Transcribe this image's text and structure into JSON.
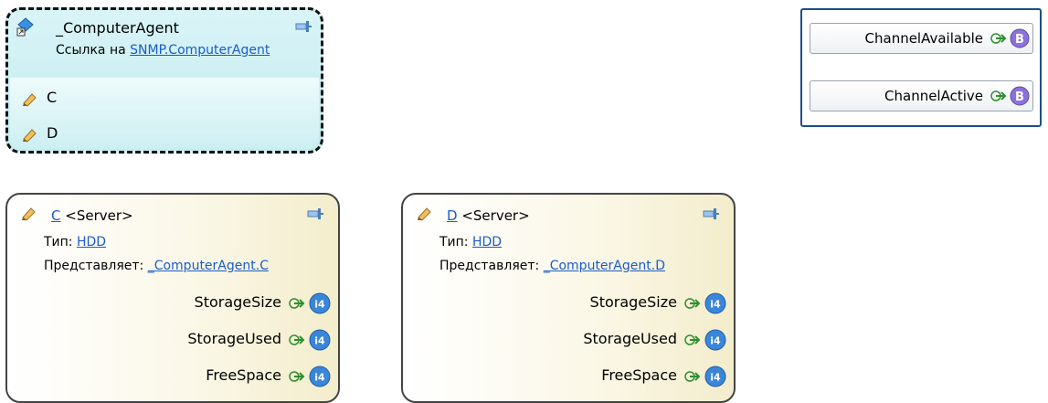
{
  "agent": {
    "title": "_ComputerAgent",
    "ref_prefix": "Ссылка на ",
    "ref_link": "SNMP.ComputerAgent",
    "items": [
      "C",
      "D"
    ]
  },
  "channels": [
    {
      "label": "ChannelAvailable",
      "badge": "B"
    },
    {
      "label": "ChannelActive",
      "badge": "B"
    }
  ],
  "servers": [
    {
      "name": "C",
      "type_tag": " <Server>",
      "type_label": "Тип: ",
      "type_value": "HDD",
      "represents_label": "Представляет: ",
      "represents_value": "_ComputerAgent.C",
      "props": [
        {
          "label": "StorageSize",
          "badge": "i4"
        },
        {
          "label": "StorageUsed",
          "badge": "i4"
        },
        {
          "label": "FreeSpace",
          "badge": "i4"
        }
      ]
    },
    {
      "name": "D",
      "type_tag": " <Server>",
      "type_label": "Тип: ",
      "type_value": "HDD",
      "represents_label": "Представляет: ",
      "represents_value": "_ComputerAgent.D",
      "props": [
        {
          "label": "StorageSize",
          "badge": "i4"
        },
        {
          "label": "StorageUsed",
          "badge": "i4"
        },
        {
          "label": "FreeSpace",
          "badge": "i4"
        }
      ]
    }
  ],
  "colors": {
    "link": "#1a5cc8",
    "badge_channel": "#8a72d8",
    "badge_prop": "#3a86d8",
    "arrow": "#2f8f2f",
    "channels_border": "#1a4f87"
  }
}
